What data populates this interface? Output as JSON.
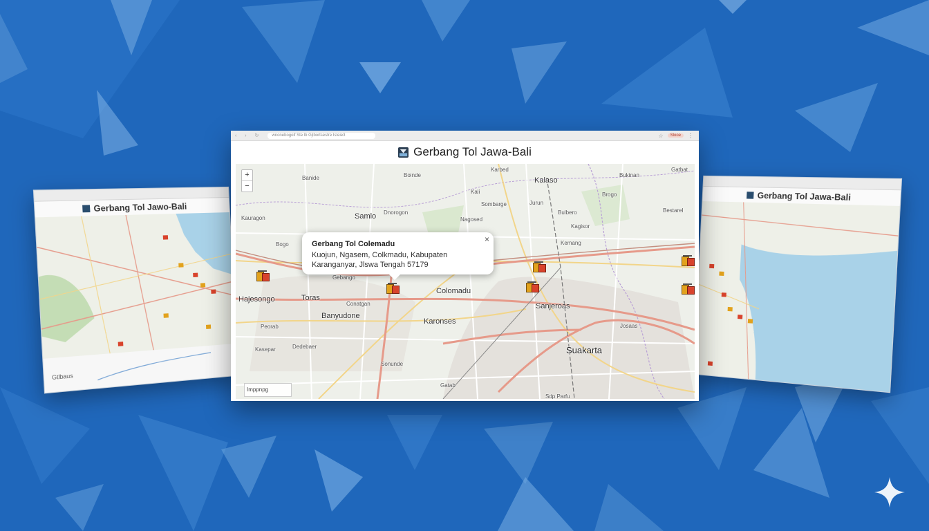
{
  "app": {
    "title": "Gerbang Tol Jawa-Bali",
    "url": "wnonebogoif Ste lb Gjlbortsestre Isteie3",
    "profile": "Slooe"
  },
  "map": {
    "zoom_in": "+",
    "zoom_out": "−",
    "scale_label": "Imppnpg",
    "places": [
      {
        "name": "Karbed",
        "size": "small"
      },
      {
        "name": "Kalaso",
        "size": "mid"
      },
      {
        "name": "Bukinan",
        "size": "small"
      },
      {
        "name": "Gatbat",
        "size": "small"
      },
      {
        "name": "Banide",
        "size": "small"
      },
      {
        "name": "Boinde",
        "size": "small"
      },
      {
        "name": "Kali",
        "size": "small"
      },
      {
        "name": "Brogo",
        "size": "small"
      },
      {
        "name": "Sombarge",
        "size": "small"
      },
      {
        "name": "Jurun",
        "size": "small"
      },
      {
        "name": "Bulbero",
        "size": "small"
      },
      {
        "name": "Bestarel",
        "size": "small"
      },
      {
        "name": "Samlo",
        "size": "mid"
      },
      {
        "name": "Dnorogon",
        "size": "small"
      },
      {
        "name": "Nagosed",
        "size": "small"
      },
      {
        "name": "Kagisor",
        "size": "small"
      },
      {
        "name": "Bogo",
        "size": "small"
      },
      {
        "name": "Kauragon",
        "size": "small"
      },
      {
        "name": "Kemang",
        "size": "small"
      },
      {
        "name": "Gebango",
        "size": "small"
      },
      {
        "name": "Hajesongo",
        "size": "mid"
      },
      {
        "name": "Toras",
        "size": "mid"
      },
      {
        "name": "Colomadu",
        "size": "mid"
      },
      {
        "name": "Conatgan",
        "size": "small"
      },
      {
        "name": "Banyudone",
        "size": "mid"
      },
      {
        "name": "Karonses",
        "size": "mid"
      },
      {
        "name": "Sanjeroas",
        "size": "mid"
      },
      {
        "name": "Josaas",
        "size": "small"
      },
      {
        "name": "Peorab",
        "size": "small"
      },
      {
        "name": "Kasepar",
        "size": "small"
      },
      {
        "name": "Dedebaer",
        "size": "small"
      },
      {
        "name": "Suakarta",
        "size": "big"
      },
      {
        "name": "Sonunde",
        "size": "small"
      },
      {
        "name": "Gatab",
        "size": "small"
      },
      {
        "name": "Sdp Parfu",
        "size": "small"
      }
    ],
    "popup": {
      "title": "Gerbang Tol Colemadu",
      "address": "Kuojun, Ngasem, Colkmadu, Kabupaten Karanganyar, Jlswa Tengah 57179",
      "close": "×"
    }
  },
  "left_window": {
    "title": "Gerbang Tol Jawo-Bali",
    "chart_label": "Gtlbaus"
  },
  "right_window": {
    "title": "Gerbang Tol Jawa-Bali"
  },
  "colors": {
    "background": "#1f67bb",
    "road_major": "#e69a8a",
    "road_minor": "#f2d58a",
    "sea": "#a9d2e8"
  }
}
